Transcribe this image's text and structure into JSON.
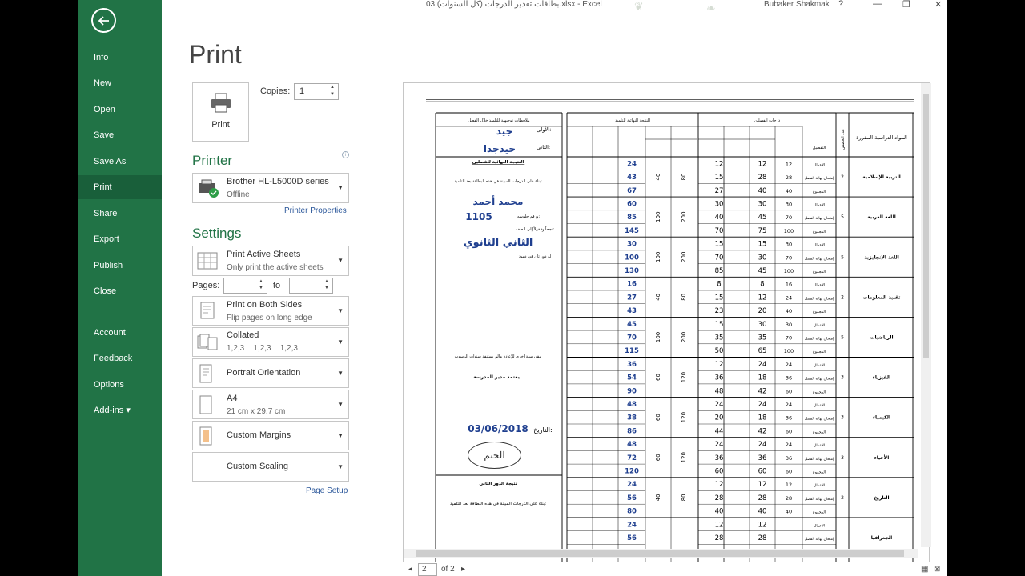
{
  "titlebar": {
    "doc_title": "بطاقات تقدير الدرجات (كل السنوات) 03.xlsx - Excel",
    "user": "Bubaker Shakmak",
    "help": "?",
    "minimize": "—",
    "restore": "❐",
    "close": "✕"
  },
  "nav": {
    "items": [
      "Info",
      "New",
      "Open",
      "Save",
      "Save As",
      "Print",
      "Share",
      "Export",
      "Publish",
      "Close",
      "Account",
      "Feedback",
      "Options",
      "Add-ins ▾"
    ],
    "active": "Print"
  },
  "print": {
    "title": "Print",
    "print_button": "Print",
    "copies_label": "Copies:",
    "copies_value": "1"
  },
  "printer": {
    "heading": "Printer",
    "name": "Brother HL-L5000D series",
    "status": "Offline",
    "properties_link": "Printer Properties"
  },
  "settings": {
    "heading": "Settings",
    "sheets_main": "Print Active Sheets",
    "sheets_sub": "Only print the active sheets",
    "pages_label": "Pages:",
    "to_label": "to",
    "sides_main": "Print on Both Sides",
    "sides_sub": "Flip pages on long edge",
    "collate_main": "Collated",
    "collate_sub": "1,2,3    1,2,3    1,2,3",
    "orientation": "Portrait Orientation",
    "paper_main": "A4",
    "paper_sub": "21 cm x 29.7 cm",
    "margins": "Custom Margins",
    "scaling": "Custom Scaling",
    "page_setup_link": "Page Setup"
  },
  "pager": {
    "current": "2",
    "of": "of 2"
  },
  "preview": {
    "headers": {
      "subjects": "المواد الدراسية المقررة",
      "hours": "عدد الحصص",
      "details": "التفصيل",
      "term_grades": "درجات الفصلين",
      "final_result": "النتيجة النهائية للتلميذ",
      "notes": "ملاحظات توجيهية للتلميذ خلال الفصل"
    },
    "rating_label1": "الأولى:",
    "rating_value1": "جيد",
    "rating_label2": "الثاني:",
    "rating_value2": "جيدجدا",
    "final_heading": "النتيجة النهائية للفصلين",
    "based_text": "بناء على الدرجات المبينة في هذه البطاقة بعد للتلميذ:",
    "student_name": "محمد أحمد",
    "seat_label": "ورقم جلوسه:",
    "seat_number": "1105",
    "passed_text": "نجحاً وفقولاً إلى الصف:",
    "grade_level": "الثاني الثانوي",
    "retry_text": "له دور ثان في دمود",
    "retry_year": "يبقى سنة أخرى للإعادة مالم يستنفذ سنوات الرسوب",
    "principal": "يعتمد مدير المدرسة",
    "date_label": "التاريخ:",
    "date_value": "03/06/2018",
    "stamp": "الختم",
    "second_round": "نتيجة الدور الثاني",
    "second_based": "بناء على الدرجات المبينة في هذه البطاقة بعد التلميذ:",
    "row_labels": [
      "الأعمال",
      "إمتحان نهاية الفصل",
      "المجموع"
    ],
    "subjects": [
      {
        "name": "التربية الإسلامية",
        "hours": "2",
        "full": [
          "12",
          "28",
          "40"
        ],
        "t1": [
          "12",
          "28",
          "40"
        ],
        "t2": [
          "12",
          "15",
          "27"
        ],
        "max": "80",
        "min": "40",
        "total": [
          "24",
          "43",
          "67"
        ]
      },
      {
        "name": "اللغة العربية",
        "hours": "5",
        "full": [
          "30",
          "70",
          "100"
        ],
        "t1": [
          "30",
          "45",
          "75"
        ],
        "t2": [
          "30",
          "40",
          "70"
        ],
        "max": "200",
        "min": "100",
        "total": [
          "60",
          "85",
          "145"
        ]
      },
      {
        "name": "اللغة الإنجليزية",
        "hours": "5",
        "full": [
          "30",
          "70",
          "100"
        ],
        "t1": [
          "15",
          "30",
          "45"
        ],
        "t2": [
          "15",
          "70",
          "85"
        ],
        "max": "200",
        "min": "100",
        "total": [
          "30",
          "100",
          "130"
        ]
      },
      {
        "name": "تقنية المعلومات",
        "hours": "2",
        "full": [
          "16",
          "24",
          "40"
        ],
        "t1": [
          "8",
          "12",
          "20"
        ],
        "t2": [
          "8",
          "15",
          "23"
        ],
        "max": "80",
        "min": "40",
        "total": [
          "16",
          "27",
          "43"
        ]
      },
      {
        "name": "الرياضيات",
        "hours": "5",
        "full": [
          "30",
          "70",
          "100"
        ],
        "t1": [
          "30",
          "35",
          "65"
        ],
        "t2": [
          "15",
          "35",
          "50"
        ],
        "max": "200",
        "min": "100",
        "total": [
          "45",
          "70",
          "115"
        ]
      },
      {
        "name": "الفيزياء",
        "hours": "3",
        "full": [
          "24",
          "36",
          "60"
        ],
        "t1": [
          "24",
          "18",
          "42"
        ],
        "t2": [
          "12",
          "36",
          "48"
        ],
        "max": "120",
        "min": "60",
        "total": [
          "36",
          "54",
          "90"
        ]
      },
      {
        "name": "الكيمياء",
        "hours": "3",
        "full": [
          "24",
          "36",
          "60"
        ],
        "t1": [
          "24",
          "18",
          "42"
        ],
        "t2": [
          "24",
          "20",
          "44"
        ],
        "max": "120",
        "min": "60",
        "total": [
          "48",
          "38",
          "86"
        ]
      },
      {
        "name": "الأحياء",
        "hours": "3",
        "full": [
          "24",
          "36",
          "60"
        ],
        "t1": [
          "24",
          "36",
          "60"
        ],
        "t2": [
          "24",
          "36",
          "60"
        ],
        "max": "120",
        "min": "60",
        "total": [
          "48",
          "72",
          "120"
        ]
      },
      {
        "name": "التاريخ",
        "hours": "2",
        "full": [
          "12",
          "28",
          "40"
        ],
        "t1": [
          "12",
          "28",
          "40"
        ],
        "t2": [
          "12",
          "28",
          "40"
        ],
        "max": "80",
        "min": "40",
        "total": [
          "24",
          "56",
          "80"
        ]
      },
      {
        "name": "الجغرافيا",
        "hours": "",
        "full": [
          "",
          "",
          ""
        ],
        "t1": [
          "12",
          "28",
          ""
        ],
        "t2": [
          "12",
          "28",
          ""
        ],
        "max": "",
        "min": "",
        "total": [
          "24",
          "56",
          ""
        ]
      }
    ]
  },
  "colors": {
    "backstage": "#217346",
    "accent": "#217346",
    "link": "#2b579a"
  }
}
